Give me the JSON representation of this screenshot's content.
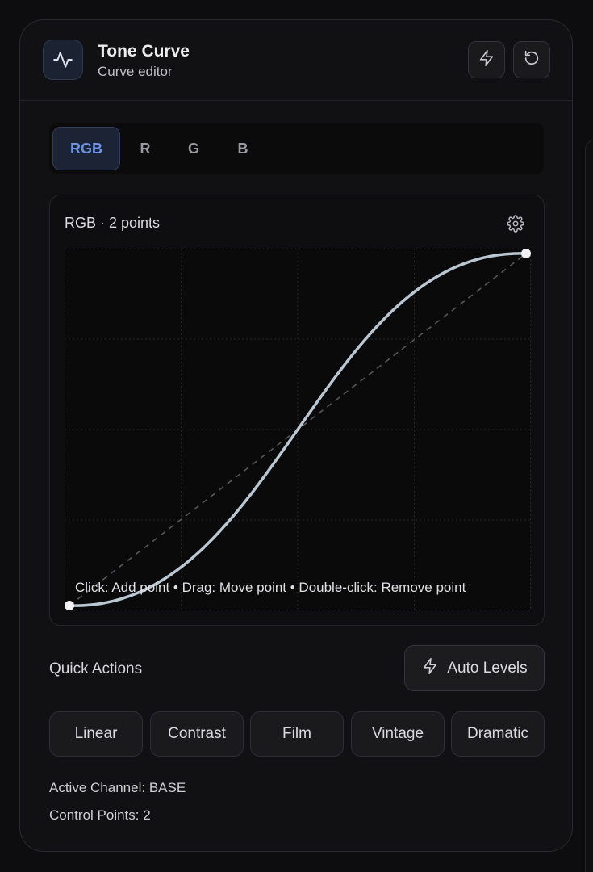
{
  "header": {
    "title": "Tone Curve",
    "subtitle": "Curve editor",
    "icons": {
      "app": "pulse-icon",
      "auto": "lightning-icon",
      "reset": "rotate-ccw-icon"
    }
  },
  "tabs": [
    {
      "label": "RGB",
      "active": true
    },
    {
      "label": "R",
      "active": false
    },
    {
      "label": "G",
      "active": false
    },
    {
      "label": "B",
      "active": false
    }
  ],
  "curve": {
    "header": "RGB · 2 points",
    "hint": "Click: Add point • Drag: Move point • Double-click: Remove point",
    "settings_icon": "gear-icon",
    "points": [
      [
        0,
        0
      ],
      [
        1,
        1
      ]
    ],
    "curve_color": "#b9c7d2",
    "reference_color": "#5a5a5e"
  },
  "quick_actions": {
    "label": "Quick Actions",
    "auto_levels": "Auto Levels",
    "presets": [
      "Linear",
      "Contrast",
      "Film",
      "Vintage",
      "Dramatic"
    ]
  },
  "info": {
    "channel_label": "Active Channel:",
    "channel_value": "BASE",
    "points_label": "Control Points:",
    "points_value": "2"
  },
  "colors": {
    "accent": "#6b94e6",
    "background": "#111113"
  }
}
